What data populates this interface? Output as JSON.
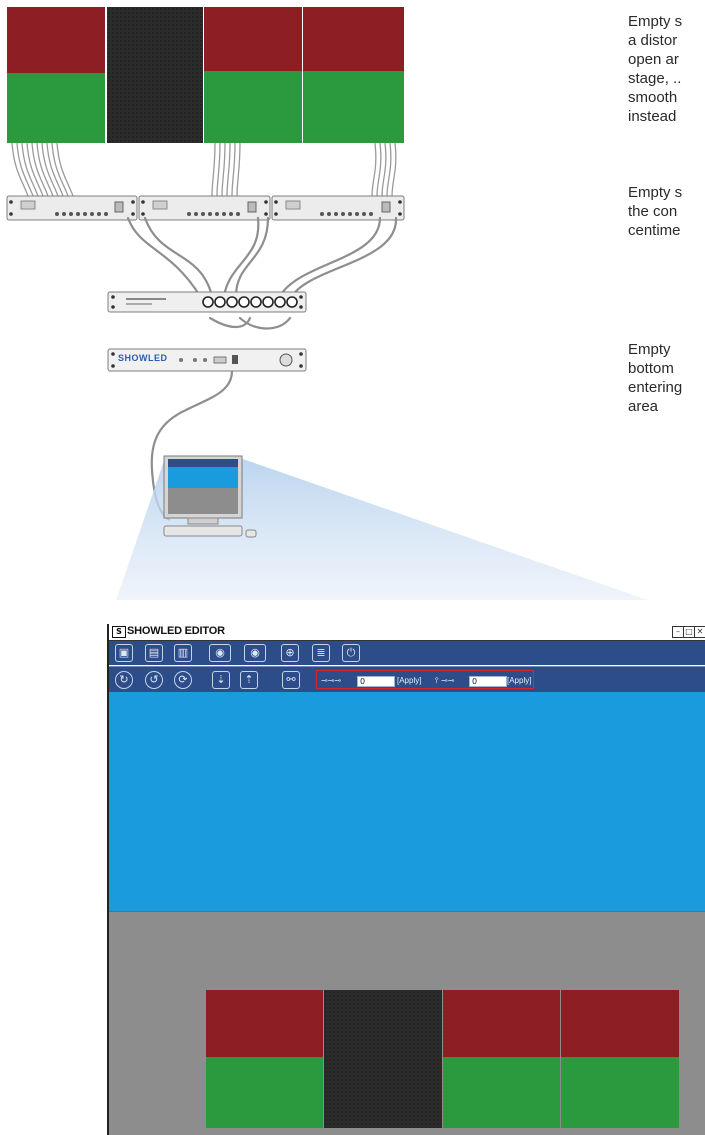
{
  "side_notes": [
    {
      "text": "Empty s\na distor\nopen ar\nstage, ..\nsmooth\ninstead"
    },
    {
      "text": "Empty s\nthe con\ncentime"
    },
    {
      "text": "Empty \nbottom\nentering\narea"
    }
  ],
  "devices": {
    "processor_label": "SHOWLED"
  },
  "editor": {
    "title": "SHOWLED EDITOR",
    "logo": "S",
    "window_controls": [
      "minimize",
      "maximize",
      "close"
    ],
    "field1_value": "0",
    "field2_value": "0",
    "apply1_label": "[Apply]",
    "apply2_label": "[Apply]"
  },
  "colors": {
    "led_red": "#8c1e24",
    "led_green": "#2b9a3e",
    "led_black": "#2b2b2b",
    "toolbar_blue": "#2c4d8a",
    "canvas_blue": "#1a9bde",
    "canvas_gray": "#8d8d8d",
    "highlight_red": "#d9262b"
  }
}
